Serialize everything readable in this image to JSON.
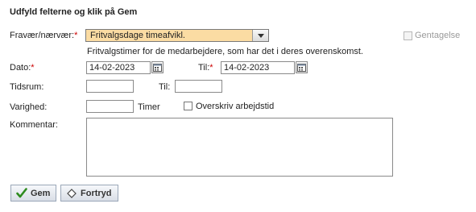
{
  "form": {
    "heading": "Udfyld felterne og klik på Gem",
    "absence": {
      "label": "Fravær/nærvær:",
      "required_mark": "*",
      "selected": "Fritvalgsdage timeafvikl.",
      "description": "Fritvalgstimer for de medarbejdere, som har det i deres overenskomst."
    },
    "recurrence": {
      "label": "Gentagelse",
      "checked": false,
      "enabled": false
    },
    "date_from": {
      "label": "Dato:",
      "required_mark": "*",
      "value": "14-02-2023"
    },
    "date_to": {
      "label": "Til:",
      "required_mark": "*",
      "value": "14-02-2023"
    },
    "time_from": {
      "label": "Tidsrum:",
      "value": ""
    },
    "time_to": {
      "label": "Til:",
      "value": ""
    },
    "duration": {
      "label": "Varighed:",
      "value": "",
      "unit": "Timer"
    },
    "overwrite": {
      "label": "Overskriv arbejdstid",
      "checked": false
    },
    "comment": {
      "label": "Kommentar:",
      "value": ""
    }
  },
  "buttons": {
    "save": "Gem",
    "cancel": "Fortryd"
  },
  "colors": {
    "select_highlight": "#fbdca3",
    "required": "#cc0000",
    "save_icon": "#2e8b1e"
  },
  "icons": {
    "select_toggle": "chevron-down-icon",
    "date_picker": "calendar-icon",
    "save": "checkmark-icon",
    "cancel": "diamond-icon"
  }
}
